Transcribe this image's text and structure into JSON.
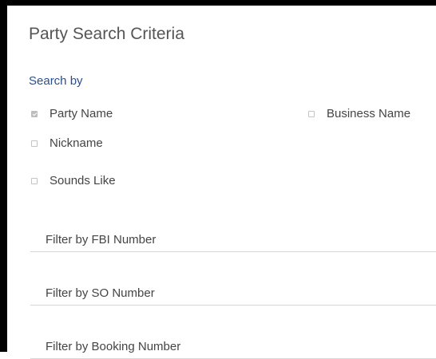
{
  "panel": {
    "title": "Party Search Criteria"
  },
  "search_by": {
    "label": "Search by",
    "options": [
      {
        "label": "Party Name",
        "checked": true
      },
      {
        "label": "Business Name",
        "checked": false
      },
      {
        "label": "Nickname",
        "checked": false
      },
      {
        "label": "Sounds Like",
        "checked": false
      }
    ]
  },
  "filters": [
    {
      "placeholder": "Filter by FBI Number",
      "value": ""
    },
    {
      "placeholder": "Filter by SO Number",
      "value": ""
    },
    {
      "placeholder": "Filter by Booking Number",
      "value": ""
    }
  ]
}
